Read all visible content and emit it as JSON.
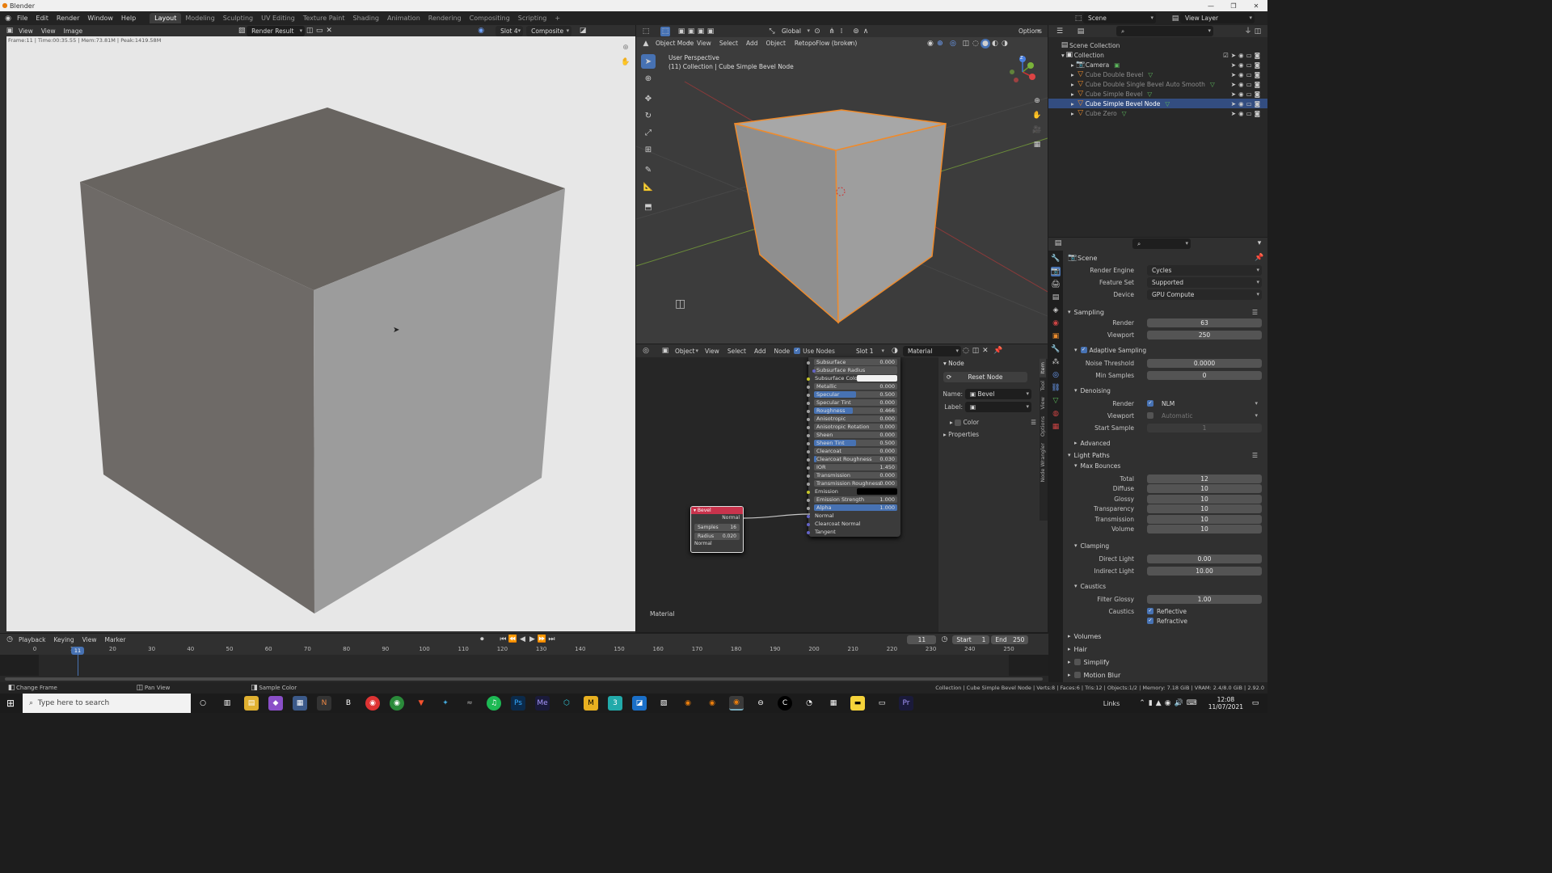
{
  "app": {
    "title": "Blender"
  },
  "menu": [
    "File",
    "Edit",
    "Render",
    "Window",
    "Help"
  ],
  "workspaces": [
    "Layout",
    "Modeling",
    "Sculpting",
    "UV Editing",
    "Texture Paint",
    "Shading",
    "Animation",
    "Rendering",
    "Compositing",
    "Scripting"
  ],
  "scene": {
    "name": "Scene",
    "view_layer": "View Layer"
  },
  "image_editor": {
    "menus": [
      "View",
      "View",
      "Image"
    ],
    "image_name": "Render Result",
    "slot": "Slot 4",
    "pass": "Composite",
    "stats": "Frame:11 | Time:00:35.55 | Mem:73.81M | Peak:1419.58M"
  },
  "viewport": {
    "mode": "Object Mode",
    "menus": [
      "View",
      "Select",
      "Add",
      "Object"
    ],
    "addon": "RetopoFlow (broken)",
    "orientation": "Global",
    "options": "Options",
    "perspective": "User Perspective",
    "collection_info": "(11) Collection | Cube Simple Bevel Node",
    "axes": [
      "X",
      "Y",
      "Z"
    ]
  },
  "node_editor": {
    "type": "Object",
    "menus": [
      "View",
      "Select",
      "Add",
      "Node"
    ],
    "use_nodes": "Use Nodes",
    "slot": "Slot 1",
    "material": "Material",
    "footer": "Material",
    "bsdf_rows": [
      {
        "n": "Subsurface",
        "v": "0.000"
      },
      {
        "n": "Subsurface Radius",
        "v": ""
      },
      {
        "n": "Subsurface Color",
        "v": ""
      },
      {
        "n": "Metallic",
        "v": "0.000"
      },
      {
        "n": "Specular",
        "v": "0.500",
        "f": 0.5
      },
      {
        "n": "Specular Tint",
        "v": "0.000"
      },
      {
        "n": "Roughness",
        "v": "0.466",
        "f": 0.466
      },
      {
        "n": "Anisotropic",
        "v": "0.000"
      },
      {
        "n": "Anisotropic Rotation",
        "v": "0.000"
      },
      {
        "n": "Sheen",
        "v": "0.000"
      },
      {
        "n": "Sheen Tint",
        "v": "0.500",
        "f": 0.5
      },
      {
        "n": "Clearcoat",
        "v": "0.000"
      },
      {
        "n": "Clearcoat Roughness",
        "v": "0.030",
        "f": 0.03
      },
      {
        "n": "IOR",
        "v": "1.450"
      },
      {
        "n": "Transmission",
        "v": "0.000"
      },
      {
        "n": "Transmission Roughness",
        "v": "0.000"
      },
      {
        "n": "Emission",
        "v": ""
      },
      {
        "n": "Emission Strength",
        "v": "1.000"
      },
      {
        "n": "Alpha",
        "v": "1.000",
        "f": 1
      },
      {
        "n": "Normal",
        "v": ""
      },
      {
        "n": "Clearcoat Normal",
        "v": ""
      },
      {
        "n": "Tangent",
        "v": ""
      }
    ],
    "bevel_node": {
      "title": "Bevel",
      "out": "Normal",
      "samples_label": "Samples",
      "samples": "16",
      "radius_label": "Radius",
      "radius": "0.020",
      "in": "Normal"
    },
    "sidebar": {
      "section": "Node",
      "reset": "Reset Node",
      "name_label": "Name:",
      "name": "Bevel",
      "label_label": "Label:",
      "color": "Color",
      "properties": "Properties",
      "tabs": [
        "Item",
        "Tool",
        "View",
        "Options",
        "Node Wrangler"
      ]
    }
  },
  "outliner": {
    "title": "Scene Collection",
    "collection": "Collection",
    "items": [
      "Camera",
      "Cube Double Bevel",
      "Cube Double Single Bevel Auto Smooth",
      "Cube Simple Bevel",
      "Cube Simple Bevel Node",
      "Cube Zero"
    ]
  },
  "properties": {
    "scene": "Scene",
    "render_engine_label": "Render Engine",
    "render_engine": "Cycles",
    "feature_set_label": "Feature Set",
    "feature_set": "Supported",
    "device_label": "Device",
    "device": "GPU Compute",
    "sampling": "Sampling",
    "render_label": "Render",
    "render_samples": "63",
    "viewport_label": "Viewport",
    "viewport_samples": "250",
    "adaptive": "Adaptive Sampling",
    "noise_label": "Noise Threshold",
    "noise": "0.0000",
    "min_label": "Min Samples",
    "min": "0",
    "denoising": "Denoising",
    "den_render_label": "Render",
    "den_render": "NLM",
    "den_viewport_label": "Viewport",
    "den_viewport": "Automatic",
    "start_sample_label": "Start Sample",
    "start_sample": "1",
    "advanced": "Advanced",
    "light_paths": "Light Paths",
    "max_bounces": "Max Bounces",
    "bounces": [
      {
        "l": "Total",
        "v": "12"
      },
      {
        "l": "Diffuse",
        "v": "10"
      },
      {
        "l": "Glossy",
        "v": "10"
      },
      {
        "l": "Transparency",
        "v": "10"
      },
      {
        "l": "Transmission",
        "v": "10"
      },
      {
        "l": "Volume",
        "v": "10"
      }
    ],
    "clamping": "Clamping",
    "direct_label": "Direct Light",
    "direct": "0.00",
    "indirect_label": "Indirect Light",
    "indirect": "10.00",
    "caustics": "Caustics",
    "filter_label": "Filter Glossy",
    "filter": "1.00",
    "caustics_label": "Caustics",
    "reflective": "Reflective",
    "refractive": "Refractive",
    "volumes": "Volumes",
    "hair": "Hair",
    "simplify": "Simplify",
    "motion_blur": "Motion Blur"
  },
  "timeline": {
    "menus": [
      "Playback",
      "Keying",
      "View",
      "Marker"
    ],
    "current": "11",
    "start_label": "Start",
    "start": "1",
    "end_label": "End",
    "end": "250",
    "ticks": [
      "0",
      "10",
      "20",
      "30",
      "40",
      "50",
      "60",
      "70",
      "80",
      "90",
      "100",
      "110",
      "120",
      "130",
      "140",
      "150",
      "160",
      "170",
      "180",
      "190",
      "200",
      "210",
      "220",
      "230",
      "240",
      "250"
    ]
  },
  "status": {
    "left1": "Change Frame",
    "left2": "Pan View",
    "left3": "Sample Color",
    "right": "Collection | Cube Simple Bevel Node | Verts:8 | Faces:6 | Tris:12 | Objects:1/2 | Memory: 7.18 GiB | VRAM: 2.4/8.0 GiB | 2.92.0"
  },
  "taskbar": {
    "search": "Type here to search",
    "links": "Links",
    "time": "12:08",
    "date": "11/07/2021"
  }
}
